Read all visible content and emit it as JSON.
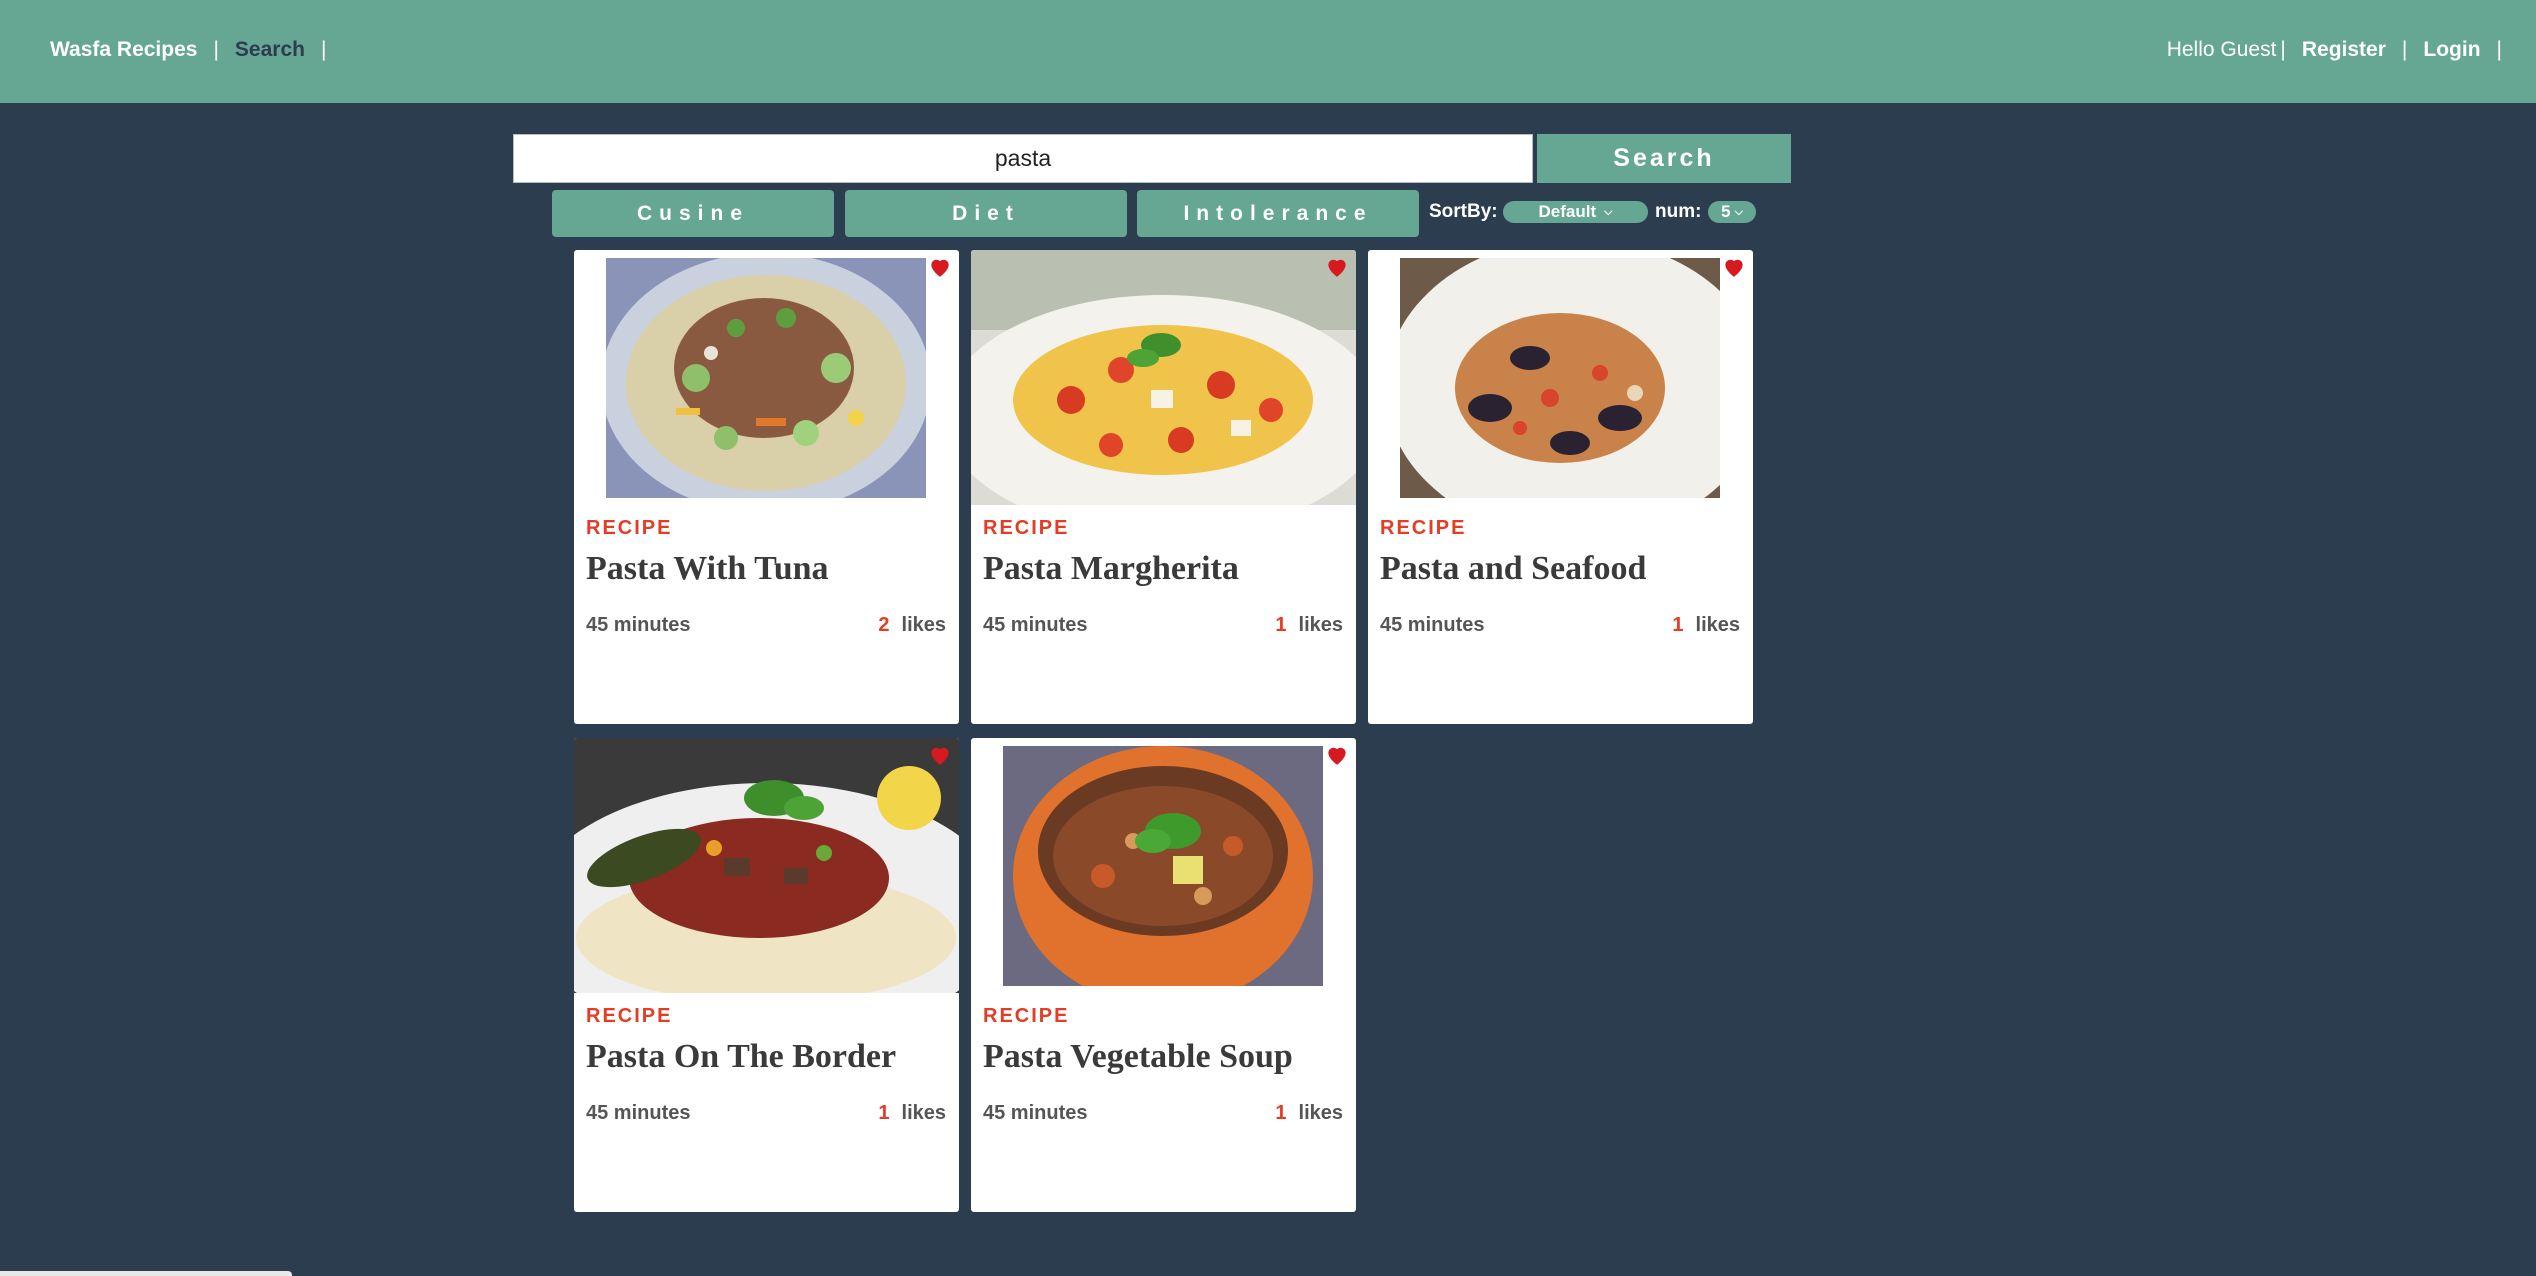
{
  "nav": {
    "brand": "Wasfa Recipes",
    "separator": "|",
    "search": "Search",
    "greeting": "Hello Guest",
    "register": "Register",
    "login": "Login"
  },
  "search": {
    "value": "pasta",
    "button": "Search"
  },
  "filters": {
    "cuisine": "Cusine",
    "diet": "Diet",
    "intolerance": "Intolerance",
    "sort_label": "SortBy:",
    "sort_value": "Default",
    "num_label": "num:",
    "num_value": "5"
  },
  "colors": {
    "header": "#65a792",
    "background": "#2d3d50",
    "accent": "#e33d26",
    "heart": "#d71920"
  },
  "recipes": [
    {
      "tag": "RECIPE",
      "title": "Pasta With Tuna",
      "time": "45 minutes",
      "likes": "2",
      "likes_label": "likes",
      "icon": "heart-icon"
    },
    {
      "tag": "RECIPE",
      "title": "Pasta Margherita",
      "time": "45 minutes",
      "likes": "1",
      "likes_label": "likes",
      "icon": "heart-icon"
    },
    {
      "tag": "RECIPE",
      "title": "Pasta and Seafood",
      "time": "45 minutes",
      "likes": "1",
      "likes_label": "likes",
      "icon": "heart-icon"
    },
    {
      "tag": "RECIPE",
      "title": "Pasta On The Border",
      "time": "45 minutes",
      "likes": "1",
      "likes_label": "likes",
      "icon": "heart-icon"
    },
    {
      "tag": "RECIPE",
      "title": "Pasta Vegetable Soup",
      "time": "45 minutes",
      "likes": "1",
      "likes_label": "likes",
      "icon": "heart-icon"
    }
  ]
}
